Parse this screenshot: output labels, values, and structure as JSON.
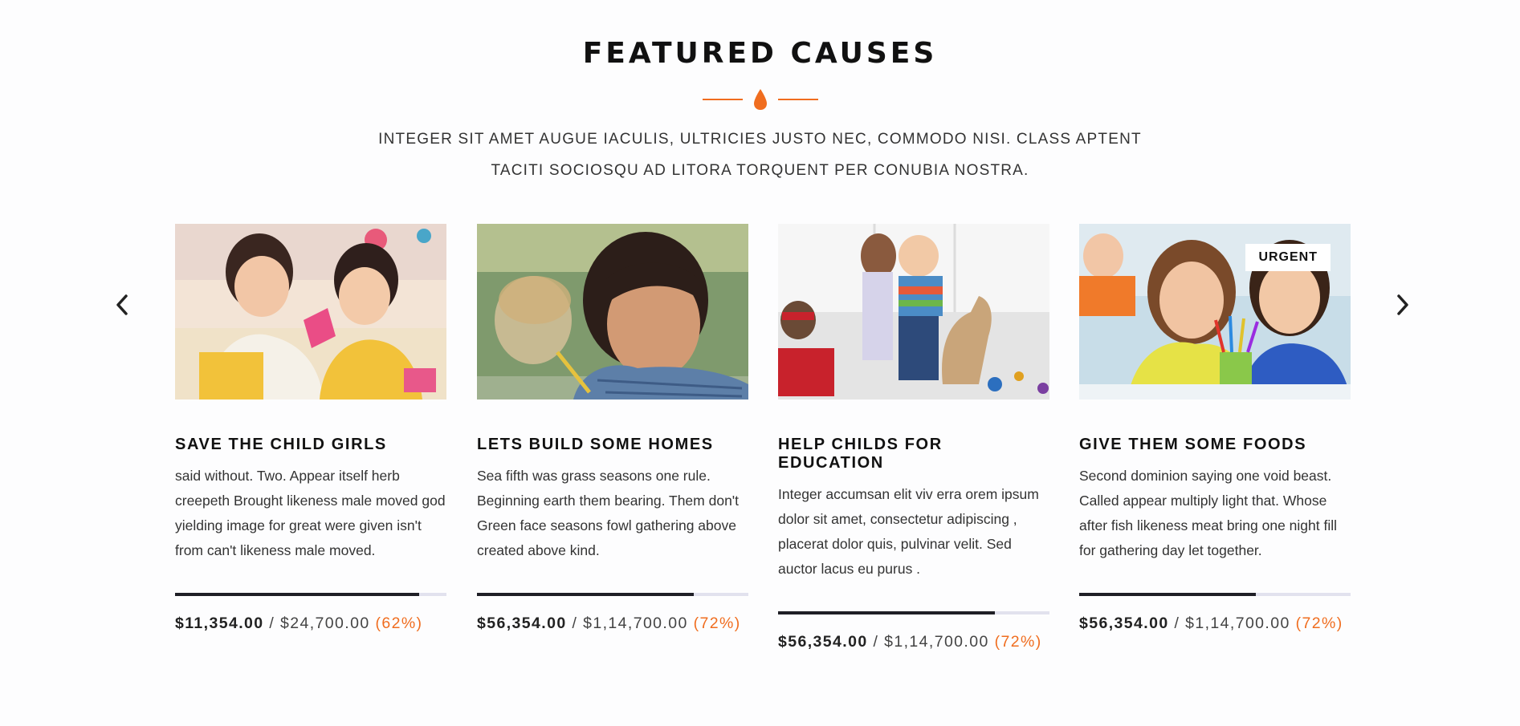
{
  "header": {
    "title": "FEATURED CAUSES",
    "subtitle_line1": "INTEGER SIT AMET AUGUE IACULIS, ULTRICIES JUSTO NEC, COMMODO NISI. CLASS APTENT",
    "subtitle_line2": "TACITI SOCIOSQU AD LITORA TORQUENT PER CONUBIA NOSTRA."
  },
  "colors": {
    "accent": "#f06d1f",
    "progress_fill": "#1f1f26",
    "progress_track": "#e2e2ee"
  },
  "carousel": {
    "prev_icon": "chevron-left-icon",
    "next_icon": "chevron-right-icon",
    "causes": [
      {
        "title": "SAVE THE CHILD GIRLS",
        "description": "said without. Two. Appear itself herb creepeth Brought likeness male moved god yielding image for great were given isn't from can't likeness male moved.",
        "raised": "$11,354.00",
        "goal": "$24,700.00",
        "percent_label": "(62%)",
        "progress": 0.9,
        "badge": ""
      },
      {
        "title": "LETS BUILD SOME HOMES",
        "description": "Sea fifth was grass seasons one rule. Beginning earth them bearing. Them don't Green face seasons fowl gathering above created above kind.",
        "raised": "$56,354.00",
        "goal": "$1,14,700.00",
        "percent_label": "(72%)",
        "progress": 0.8,
        "badge": ""
      },
      {
        "title": "HELP CHILDS FOR EDUCATION",
        "description": "Integer accumsan elit viv erra orem ipsum dolor sit amet, consectetur adipiscing , placerat dolor quis, pulvinar velit. Sed auctor lacus eu purus .",
        "raised": "$56,354.00",
        "goal": "$1,14,700.00",
        "percent_label": "(72%)",
        "progress": 0.8,
        "badge": ""
      },
      {
        "title": "GIVE THEM SOME FOODS",
        "description": "Second dominion saying one void beast. Called appear multiply light that. Whose after fish likeness meat bring one night fill for gathering day let together.",
        "raised": "$56,354.00",
        "goal": "$1,14,700.00",
        "percent_label": "(72%)",
        "progress": 0.65,
        "badge": "URGENT"
      }
    ]
  }
}
